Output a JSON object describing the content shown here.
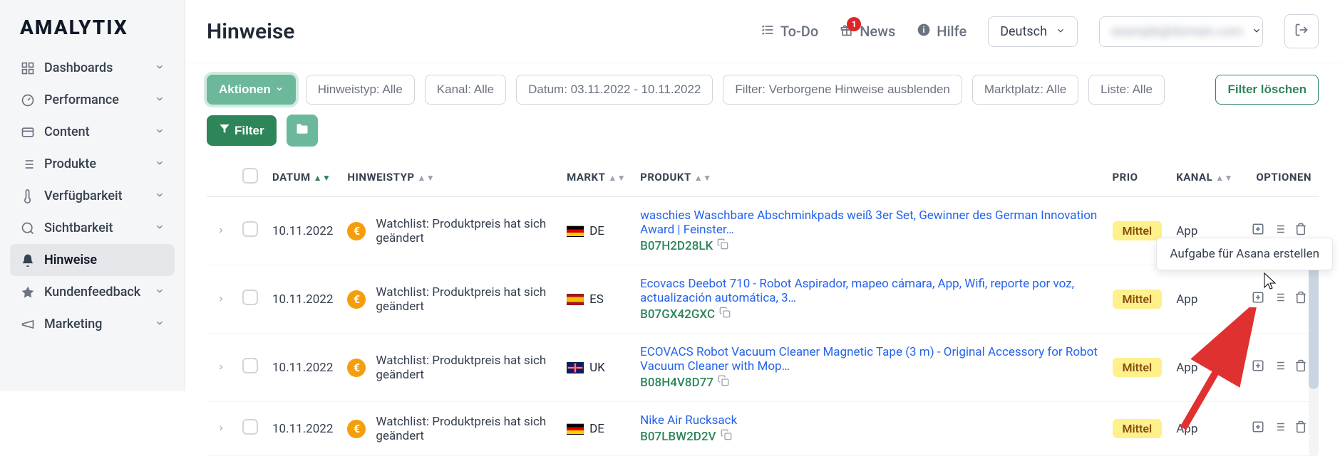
{
  "brand": "AMALYTIX",
  "nav": {
    "items": [
      {
        "label": "Dashboards",
        "icon": "dashboard"
      },
      {
        "label": "Performance",
        "icon": "gauge"
      },
      {
        "label": "Content",
        "icon": "content"
      },
      {
        "label": "Produkte",
        "icon": "list"
      },
      {
        "label": "Verfügbarkeit",
        "icon": "thermo"
      },
      {
        "label": "Sichtbarkeit",
        "icon": "search"
      },
      {
        "label": "Hinweise",
        "icon": "bell",
        "active": true
      },
      {
        "label": "Kundenfeedback",
        "icon": "star"
      },
      {
        "label": "Marketing",
        "icon": "marketing"
      }
    ]
  },
  "page_title": "Hinweise",
  "topbar": {
    "todo": "To-Do",
    "news": "News",
    "news_count": "1",
    "help": "Hilfe",
    "language": "Deutsch",
    "user": "example@domain.com"
  },
  "filters": {
    "actions": "Aktionen",
    "hint_type": "Hinweistyp: Alle",
    "channel": "Kanal: Alle",
    "date": "Datum: 03.11.2022 - 10.11.2022",
    "hidden": "Filter: Verborgene Hinweise ausblenden",
    "marketplace": "Marktplatz: Alle",
    "list": "Liste: Alle",
    "clear": "Filter löschen",
    "filter": "Filter"
  },
  "columns": {
    "date": "DATUM",
    "type": "HINWEISTYP",
    "market": "MARKT",
    "product": "PRODUKT",
    "prio": "PRIO",
    "channel": "KANAL",
    "options": "OPTIONEN"
  },
  "rows": [
    {
      "date": "10.11.2022",
      "type": "Watchlist: Produktpreis hat sich geändert",
      "market": "DE",
      "flag": "de",
      "product_title": "waschies Waschbare Abschminkpads weiß 3er Set, Gewinner des German Innovation Award | Feinster…",
      "asin": "B07H2D28LK",
      "prio": "Mittel",
      "channel": "App"
    },
    {
      "date": "10.11.2022",
      "type": "Watchlist: Produktpreis hat sich geändert",
      "market": "ES",
      "flag": "es",
      "product_title": "Ecovacs Deebot 710 - Robot Aspirador, mapeo cámara, App, Wifi, reporte por voz, actualización automática, 3…",
      "asin": "B07GX42GXC",
      "prio": "Mittel",
      "channel": "App"
    },
    {
      "date": "10.11.2022",
      "type": "Watchlist: Produktpreis hat sich geändert",
      "market": "UK",
      "flag": "uk",
      "product_title": "ECOVACS Robot Vacuum Cleaner Magnetic Tape (3 m) - Original Accessory for Robot Vacuum Cleaner with Mop…",
      "asin": "B08H4V8D77",
      "prio": "Mittel",
      "channel": "App"
    },
    {
      "date": "10.11.2022",
      "type": "Watchlist: Produktpreis hat sich geändert",
      "market": "DE",
      "flag": "de",
      "product_title": "Nike Air Rucksack",
      "asin": "B07LBW2D2V",
      "prio": "Mittel",
      "channel": "App"
    }
  ],
  "tooltip": "Aufgabe für Asana erstellen"
}
